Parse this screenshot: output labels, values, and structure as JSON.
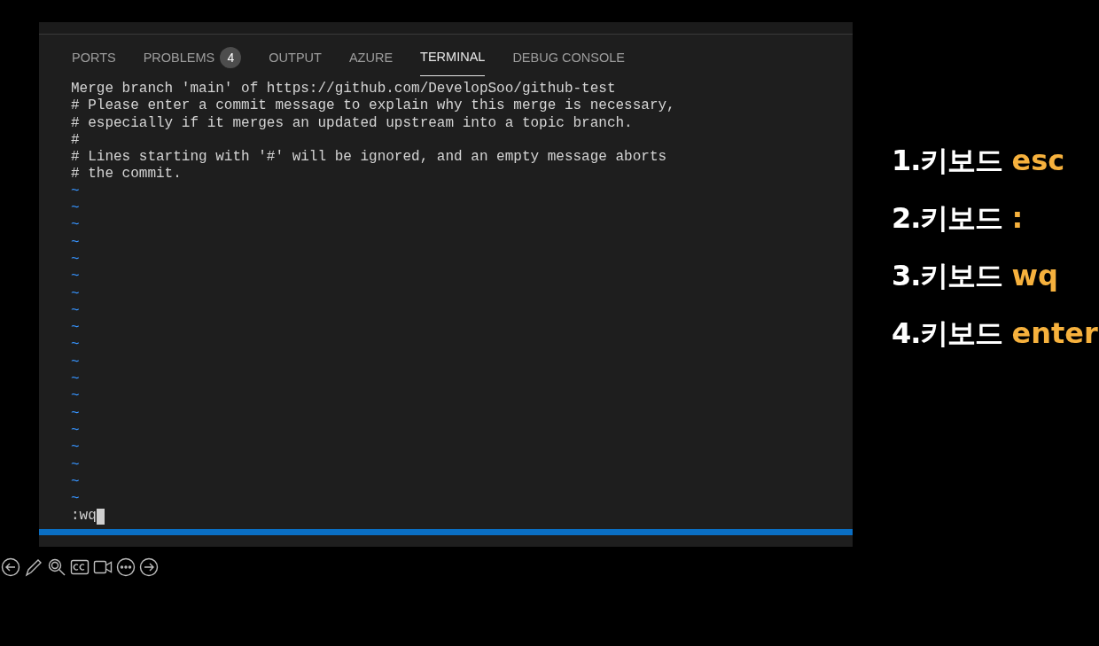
{
  "panel": {
    "tabs": [
      {
        "label": "PORTS",
        "selected": false
      },
      {
        "label": "PROBLEMS",
        "selected": false,
        "badge": "4"
      },
      {
        "label": "OUTPUT",
        "selected": false
      },
      {
        "label": "AZURE",
        "selected": false
      },
      {
        "label": "TERMINAL",
        "selected": true
      },
      {
        "label": "DEBUG CONSOLE",
        "selected": false
      }
    ],
    "terminal": {
      "lines": [
        "Merge branch 'main' of https://github.com/DevelopSoo/github-test",
        "# Please enter a commit message to explain why this merge is necessary,",
        "# especially if it merges an updated upstream into a topic branch.",
        "#",
        "# Lines starting with '#' will be ignored, and an empty message aborts",
        "# the commit."
      ],
      "empty_line_markers": [
        "~",
        "~",
        "~",
        "~",
        "~",
        "~",
        "~",
        "~",
        "~",
        "~",
        "~",
        "~",
        "~",
        "~",
        "~",
        "~",
        "~",
        "~",
        "~"
      ],
      "command": ":wq"
    }
  },
  "steps": [
    {
      "label": "1.키보드",
      "key": "esc"
    },
    {
      "label": "2.키보드",
      "key": ":"
    },
    {
      "label": "3.키보드",
      "key": "wq"
    },
    {
      "label": "4.키보드",
      "key": "enter"
    }
  ],
  "slide_toolbar": [
    {
      "kind": "back"
    },
    {
      "kind": "pen"
    },
    {
      "kind": "zoom"
    },
    {
      "kind": "captions"
    },
    {
      "kind": "camera"
    },
    {
      "kind": "more"
    },
    {
      "kind": "forward"
    }
  ]
}
